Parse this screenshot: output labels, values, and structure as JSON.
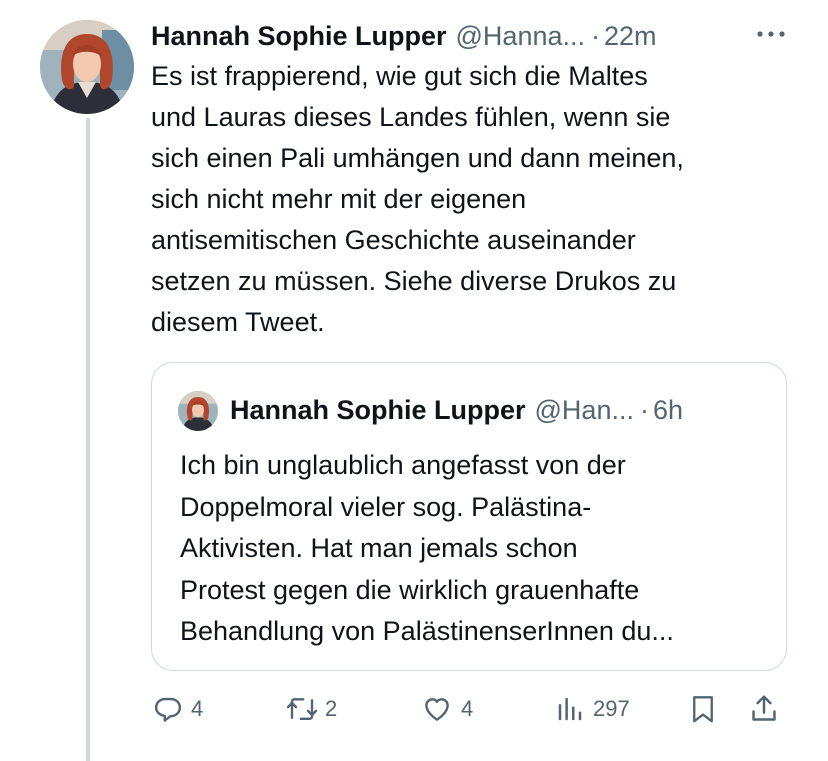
{
  "tweet": {
    "author_name": "Hannah Sophie Lupper",
    "handle": "@Hanna...",
    "separator": "·",
    "time": "22m",
    "text_lines": [
      "Es ist frappierend, wie gut sich die Maltes",
      "und Lauras dieses Landes fühlen, wenn sie",
      "sich einen Pali umhängen und dann meinen,",
      "sich nicht mehr mit der eigenen",
      "antisemitischen Geschichte auseinander",
      "setzen zu müssen. Siehe diverse Drukos zu",
      "diesem Tweet."
    ]
  },
  "quote": {
    "author_name": "Hannah Sophie Lupper",
    "handle": "@Han...",
    "separator": "·",
    "time": "6h",
    "text_lines": [
      "Ich bin unglaublich angefasst von der",
      "Doppelmoral vieler sog. Palästina-",
      "Aktivisten. Hat man jemals schon",
      "Protest gegen die wirklich grauenhafte",
      "Behandlung von PalästinenserInnen du..."
    ]
  },
  "actions": {
    "replies": "4",
    "retweets": "2",
    "likes": "4",
    "views": "297"
  },
  "icons": {
    "more": "more-dots-icon",
    "reply": "reply-icon",
    "retweet": "retweet-icon",
    "like": "heart-icon",
    "views": "views-chart-icon",
    "bookmark": "bookmark-icon",
    "share": "share-icon"
  },
  "colors": {
    "text": "#0f1419",
    "secondary": "#536471",
    "border": "#cfd9de",
    "hair": "#b0462b"
  }
}
